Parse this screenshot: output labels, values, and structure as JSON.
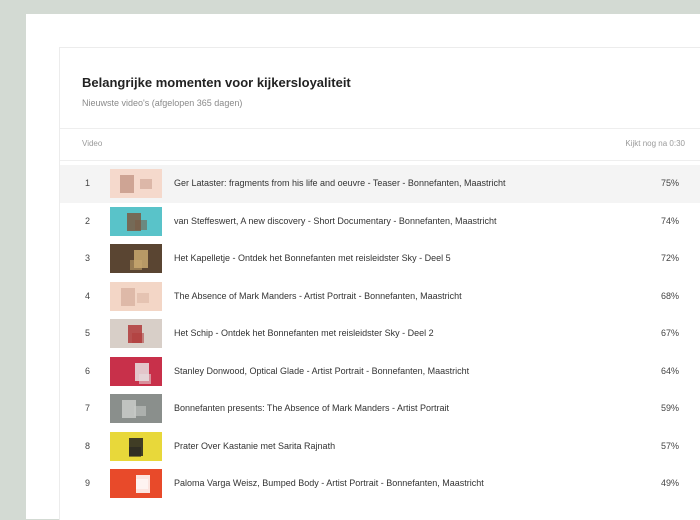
{
  "card": {
    "title": "Belangrijke momenten voor kijkersloyaliteit",
    "subtitle": "Nieuwste video's (afgelopen 365 dagen)"
  },
  "table": {
    "col_video": "Video",
    "col_metric": "Kijkt nog na 0:30"
  },
  "rows": [
    {
      "rank": "1",
      "title": "Ger Lataster: fragments from his life and oeuvre - Teaser - Bonnefanten, Maastricht",
      "pct": "75%",
      "thumb_bg": "#f5d9cc",
      "thumb_accent": "#c79a8a",
      "highlight": true
    },
    {
      "rank": "2",
      "title": "van Steffeswert, A new discovery - Short Documentary - Bonnefanten, Maastricht",
      "pct": "74%",
      "thumb_bg": "#59c3c9",
      "thumb_accent": "#7a5a43",
      "highlight": false
    },
    {
      "rank": "3",
      "title": "Het Kapelletje - Ontdek het Bonnefanten met reisleidster Sky - Deel 5",
      "pct": "72%",
      "thumb_bg": "#5a4532",
      "thumb_accent": "#c8a870",
      "highlight": false
    },
    {
      "rank": "4",
      "title": "The Absence of Mark Manders - Artist Portrait - Bonnefanten, Maastricht",
      "pct": "68%",
      "thumb_bg": "#f3d6c6",
      "thumb_accent": "#d9b4a2",
      "highlight": false
    },
    {
      "rank": "5",
      "title": "Het Schip - Ontdek het Bonnefanten met reisleidster Sky - Deel 2",
      "pct": "67%",
      "thumb_bg": "#d8cfc8",
      "thumb_accent": "#b03a3a",
      "highlight": false
    },
    {
      "rank": "6",
      "title": "Stanley Donwood, Optical Glade - Artist Portrait - Bonnefanten, Maastricht",
      "pct": "64%",
      "thumb_bg": "#c8304a",
      "thumb_accent": "#e8e0e0",
      "highlight": false
    },
    {
      "rank": "7",
      "title": "Bonnefanten presents: The Absence of Mark Manders - Artist Portrait",
      "pct": "59%",
      "thumb_bg": "#8a8f8c",
      "thumb_accent": "#c9ccc9",
      "highlight": false
    },
    {
      "rank": "8",
      "title": "Prater Over Kastanie met Sarita Rajnath",
      "pct": "57%",
      "thumb_bg": "#e8d83a",
      "thumb_accent": "#222222",
      "highlight": false
    },
    {
      "rank": "9",
      "title": "Paloma Varga Weisz, Bumped Body - Artist Portrait - Bonnefanten, Maastricht",
      "pct": "49%",
      "thumb_bg": "#e84a2a",
      "thumb_accent": "#ffffff",
      "highlight": false
    }
  ]
}
